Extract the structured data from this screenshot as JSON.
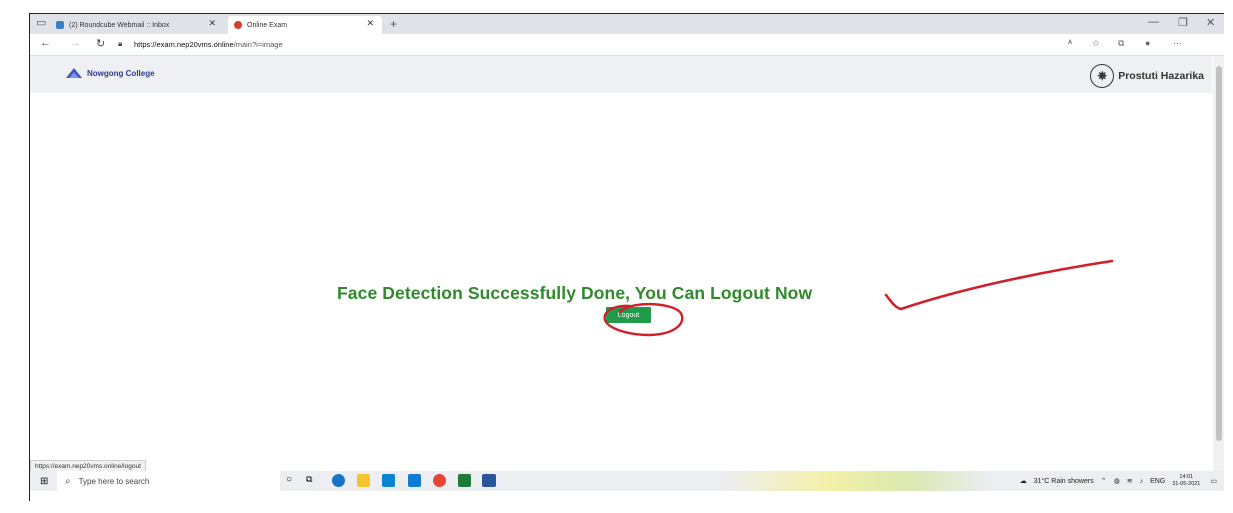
{
  "browser": {
    "tabs": [
      {
        "label": "(2) Roundcube Webmail :: Inbox",
        "close": "✕"
      },
      {
        "label": "Online Exam",
        "close": "✕"
      }
    ],
    "new_tab": "+",
    "window_controls": {
      "minimize": "—",
      "restore": "❐",
      "close": "✕"
    },
    "nav": {
      "back": "←",
      "forward": "→",
      "refresh": "↻"
    },
    "url_host": "https://exam.nep20vms.online",
    "url_path": "/main?i=image",
    "status_url": "https://exam.nep20vms.online/logout"
  },
  "site": {
    "brand": "Nowgong College",
    "user_name": "Prostuti Hazarika"
  },
  "main": {
    "message": "Face Detection Successfully Done, You Can Logout Now",
    "logout_label": "Logout"
  },
  "taskbar": {
    "search_placeholder": "Type here to search",
    "weather": "31°C  Rain showers",
    "lang": "ENG",
    "time": "14:01",
    "date": "31-05-2021"
  },
  "colors": {
    "message_green": "#2f8a2b",
    "button_green": "#1f9b4a",
    "annotation_red": "#d0202a"
  }
}
